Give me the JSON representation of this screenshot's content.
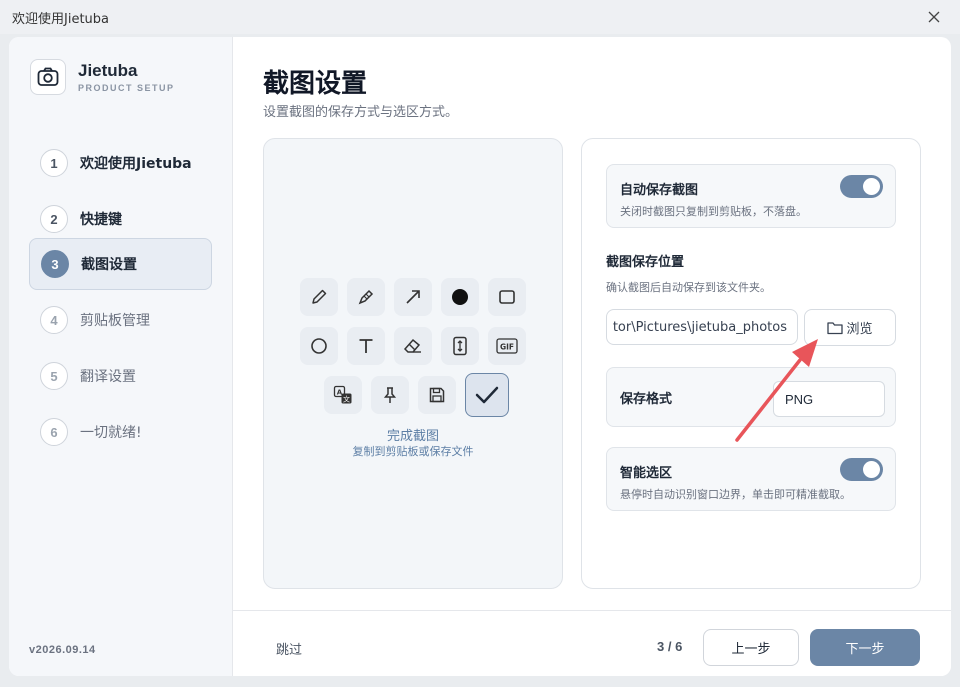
{
  "window": {
    "title": "欢迎使用Jietuba"
  },
  "brand": {
    "name": "Jietuba",
    "subtitle": "PRODUCT SETUP"
  },
  "steps": [
    {
      "num": "1",
      "label": "欢迎使用Jietuba",
      "state": "done"
    },
    {
      "num": "2",
      "label": "快捷键",
      "state": "done"
    },
    {
      "num": "3",
      "label": "截图设置",
      "state": "active"
    },
    {
      "num": "4",
      "label": "剪贴板管理",
      "state": "future"
    },
    {
      "num": "5",
      "label": "翻译设置",
      "state": "future"
    },
    {
      "num": "6",
      "label": "一切就绪!",
      "state": "future"
    }
  ],
  "version": "v2026.09.14",
  "page": {
    "title": "截图设置",
    "subtitle": "设置截图的保存方式与选区方式。"
  },
  "preview": {
    "tools": [
      "pen-icon",
      "highlighter-icon",
      "arrow-icon",
      "dot-icon",
      "rectangle-icon",
      "circle-icon",
      "text-icon",
      "eraser-icon",
      "scroll-capture-icon",
      "gif-icon",
      "translate-icon",
      "pin-icon",
      "save-icon",
      "checkmark-icon"
    ],
    "gif_label": "GIF",
    "done_title": "完成截图",
    "done_sub": "复制到剪贴板或保存文件"
  },
  "settings": {
    "auto_save": {
      "title": "自动保存截图",
      "desc": "关闭时截图只复制到剪贴板，不落盘。",
      "enabled": true
    },
    "save_location": {
      "title": "截图保存位置",
      "desc": "确认截图后自动保存到该文件夹。",
      "path": "tor\\Pictures\\jietuba_photos",
      "browse_label": "浏览"
    },
    "format": {
      "title": "保存格式",
      "value": "PNG"
    },
    "smart_select": {
      "title": "智能选区",
      "desc": "悬停时自动识别窗口边界，单击即可精准截取。",
      "enabled": true
    }
  },
  "footer": {
    "skip": "跳过",
    "pager": "3 / 6",
    "prev": "上一步",
    "next": "下一步"
  },
  "colors": {
    "accent": "#6b86a6",
    "annotation_arrow": "#e8555a"
  }
}
